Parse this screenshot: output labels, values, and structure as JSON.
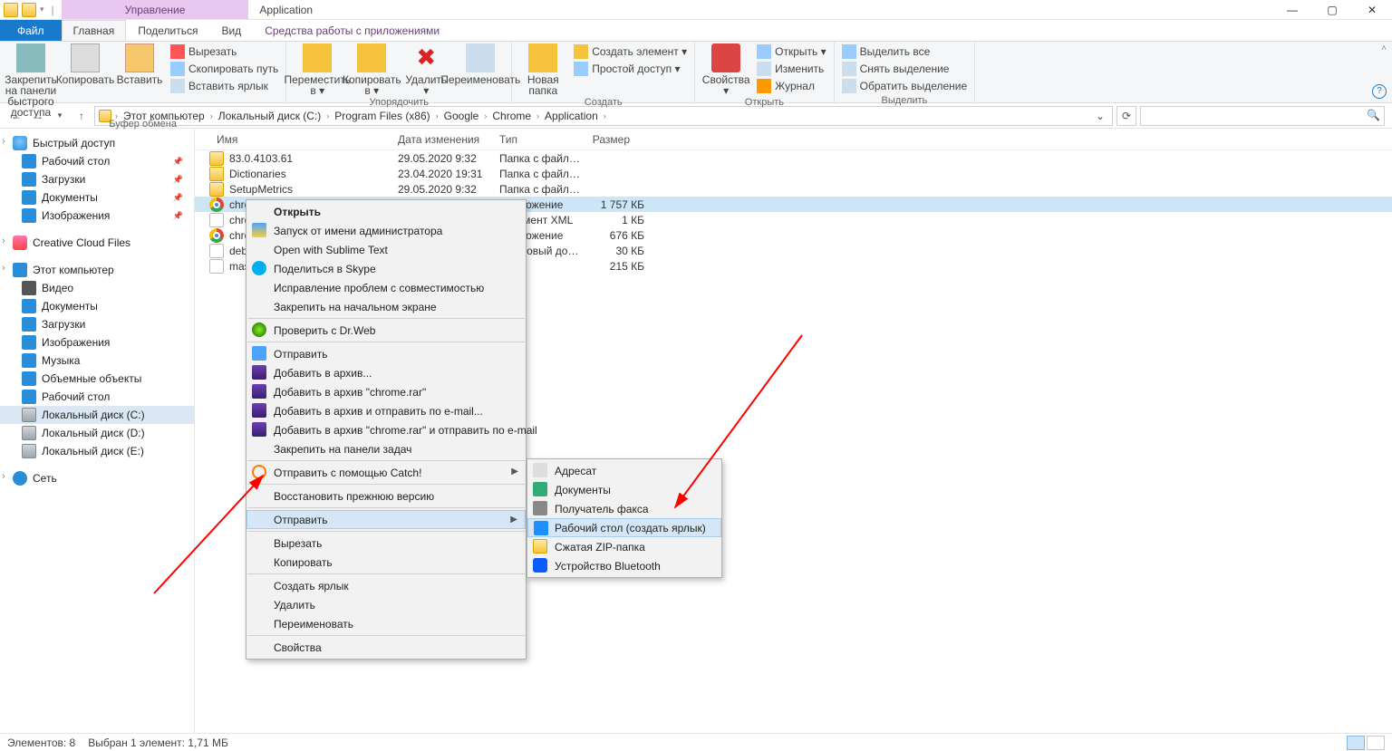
{
  "title_tab": "Управление",
  "title_sub": "Средства работы с приложениями",
  "doc_title": "Application",
  "tabs": {
    "file": "Файл",
    "home": "Главная",
    "share": "Поделиться",
    "view": "Вид"
  },
  "ribbon": {
    "pin": "Закрепить на панели\nбыстрого доступа",
    "copy": "Копировать",
    "paste": "Вставить",
    "cut": "Вырезать",
    "copypath": "Скопировать путь",
    "pastelnk": "Вставить ярлык",
    "move": "Переместить\nв ▾",
    "copyto": "Копировать\nв ▾",
    "delete": "Удалить\n▾",
    "rename": "Переименовать",
    "newfolder": "Новая\nпапка",
    "newitem": "Создать элемент ▾",
    "easyaccess": "Простой доступ ▾",
    "props": "Свойства\n▾",
    "open": "Открыть ▾",
    "edit": "Изменить",
    "history": "Журнал",
    "selall": "Выделить все",
    "selnone": "Снять выделение",
    "selinv": "Обратить выделение",
    "g_clip": "Буфер обмена",
    "g_org": "Упорядочить",
    "g_new": "Создать",
    "g_open": "Открыть",
    "g_sel": "Выделить"
  },
  "breadcrumb": [
    "Этот компьютер",
    "Локальный диск (C:)",
    "Program Files (x86)",
    "Google",
    "Chrome",
    "Application"
  ],
  "columns": {
    "name": "Имя",
    "date": "Дата изменения",
    "type": "Тип",
    "size": "Размер"
  },
  "rows": [
    {
      "ic": "fold",
      "name": "83.0.4103.61",
      "date": "29.05.2020 9:32",
      "type": "Папка с файлами",
      "size": ""
    },
    {
      "ic": "fold",
      "name": "Dictionaries",
      "date": "23.04.2020 19:31",
      "type": "Папка с файлами",
      "size": ""
    },
    {
      "ic": "fold",
      "name": "SetupMetrics",
      "date": "29.05.2020 9:32",
      "type": "Папка с файлами",
      "size": ""
    },
    {
      "ic": "chrome",
      "name": "chrome",
      "date": "",
      "type": "Приложение",
      "size": "1 757 КБ",
      "sel": true
    },
    {
      "ic": "file",
      "name": "chrome.VisualElementsManifest",
      "date": "",
      "type": "Документ XML",
      "size": "1 КБ"
    },
    {
      "ic": "chrome",
      "name": "chrome_proxy",
      "date": "",
      "type": "Приложение",
      "size": "676 КБ"
    },
    {
      "ic": "file",
      "name": "debug",
      "date": "",
      "type": "Текстовый докум…",
      "size": "30 КБ"
    },
    {
      "ic": "file",
      "name": "master_preferences",
      "date": "",
      "type": "",
      "size": "215 КБ"
    }
  ],
  "tree": {
    "quick": "Быстрый доступ",
    "quick_items": [
      {
        "ic": "desk",
        "t": "Рабочий стол",
        "pin": true
      },
      {
        "ic": "dl",
        "t": "Загрузки",
        "pin": true
      },
      {
        "ic": "docs",
        "t": "Документы",
        "pin": true
      },
      {
        "ic": "img",
        "t": "Изображения",
        "pin": true
      }
    ],
    "cc": "Creative Cloud Files",
    "pc": "Этот компьютер",
    "pc_items": [
      {
        "ic": "vid",
        "t": "Видео"
      },
      {
        "ic": "docs",
        "t": "Документы"
      },
      {
        "ic": "dl",
        "t": "Загрузки"
      },
      {
        "ic": "img",
        "t": "Изображения"
      },
      {
        "ic": "mus",
        "t": "Музыка"
      },
      {
        "ic": "obj",
        "t": "Объемные объекты"
      },
      {
        "ic": "desk",
        "t": "Рабочий стол"
      },
      {
        "ic": "hdd",
        "t": "Локальный диск (C:)",
        "sel": true
      },
      {
        "ic": "hdd",
        "t": "Локальный диск (D:)"
      },
      {
        "ic": "hdd",
        "t": "Локальный диск (E:)"
      }
    ],
    "net": "Сеть"
  },
  "ctx1": [
    {
      "t": "Открыть",
      "bold": true
    },
    {
      "t": "Запуск от имени администратора",
      "ic": "shield"
    },
    {
      "t": "Open with Sublime Text"
    },
    {
      "t": "Поделиться в Skype",
      "ic": "skype"
    },
    {
      "t": "Исправление проблем с совместимостью"
    },
    {
      "t": "Закрепить на начальном экране"
    },
    "-",
    {
      "t": "Проверить с Dr.Web",
      "ic": "drweb"
    },
    "-",
    {
      "t": "Отправить",
      "ic": "share"
    },
    {
      "t": "Добавить в архив...",
      "ic": "rar"
    },
    {
      "t": "Добавить в архив \"chrome.rar\"",
      "ic": "rar"
    },
    {
      "t": "Добавить в архив и отправить по e-mail...",
      "ic": "rar"
    },
    {
      "t": "Добавить в архив \"chrome.rar\" и отправить по e-mail",
      "ic": "rar"
    },
    {
      "t": "Закрепить на панели задач"
    },
    "-",
    {
      "t": "Отправить с помощью Catch!",
      "ic": "catch",
      "sub": true
    },
    "-",
    {
      "t": "Восстановить прежнюю версию"
    },
    "-",
    {
      "t": "Отправить",
      "sub": true,
      "hover": true
    },
    "-",
    {
      "t": "Вырезать"
    },
    {
      "t": "Копировать"
    },
    "-",
    {
      "t": "Создать ярлык"
    },
    {
      "t": "Удалить"
    },
    {
      "t": "Переименовать"
    },
    "-",
    {
      "t": "Свойства"
    }
  ],
  "ctx2": [
    {
      "t": "Адресат",
      "ic": "user"
    },
    {
      "t": "Документы",
      "ic": "docsi"
    },
    {
      "t": "Получатель факса",
      "ic": "fax"
    },
    {
      "t": "Рабочий стол (создать ярлык)",
      "ic": "deski",
      "hover": true
    },
    {
      "t": "Сжатая ZIP-папка",
      "ic": "zip"
    },
    {
      "t": "Устройство Bluetooth",
      "ic": "bt"
    }
  ],
  "status": {
    "count": "Элементов: 8",
    "sel": "Выбран 1 элемент: 1,71 МБ"
  }
}
